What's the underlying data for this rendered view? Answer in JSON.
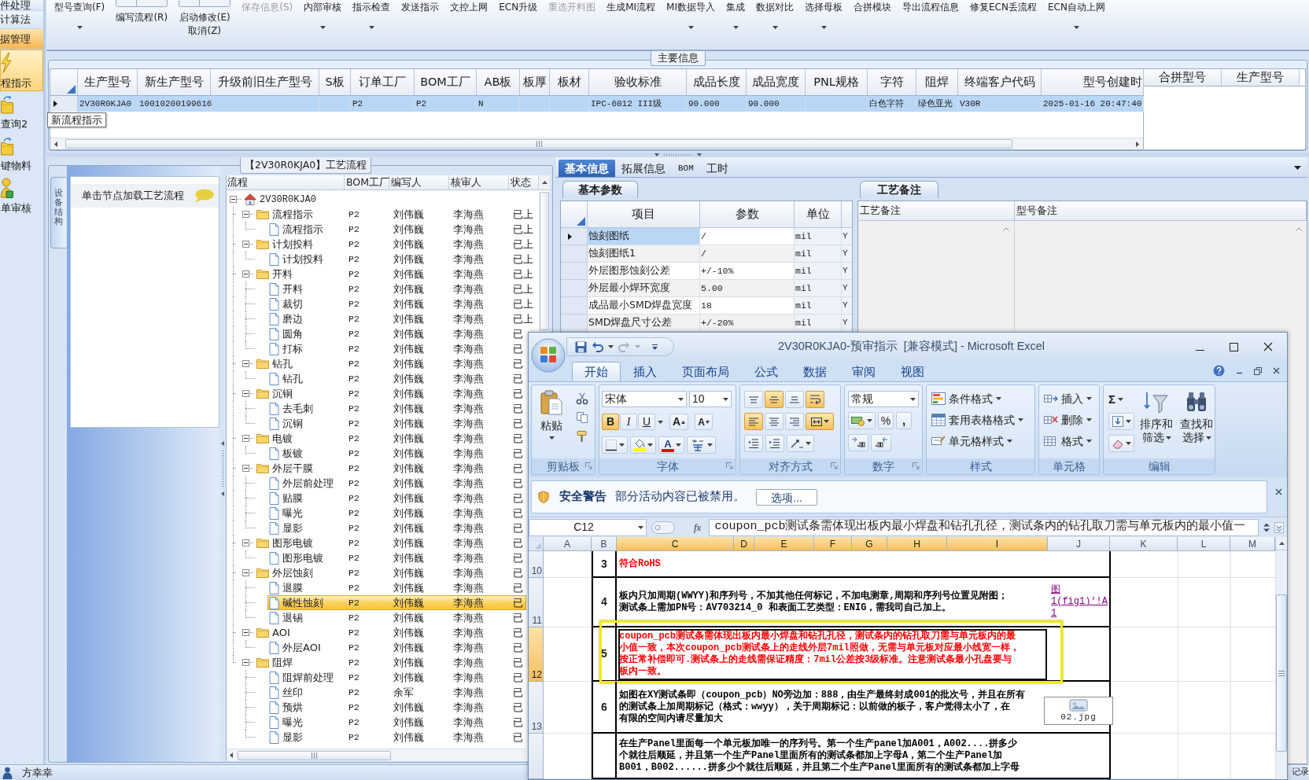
{
  "sidebar": {
    "sections": [
      {
        "label": "件处理",
        "selected": false
      },
      {
        "label": "计算法",
        "selected": false
      },
      {
        "label": "据管理",
        "selected": true
      }
    ],
    "shortcuts": [
      {
        "label": "程指示",
        "selected": true
      },
      {
        "label": "查询2",
        "selected": false
      },
      {
        "label": "键物料",
        "selected": false
      },
      {
        "label": "单审核",
        "selected": false
      }
    ]
  },
  "toolbar": {
    "buttons": [
      {
        "kind": "plain",
        "lines": [
          "型号查询(F)"
        ],
        "dropdown": true,
        "disabled": false
      },
      {
        "kind": "split",
        "lines": [
          "编写流程(R)"
        ],
        "dropdown": false,
        "disabled": false
      },
      {
        "kind": "split",
        "lines": [
          "启动修改(E)",
          "取消(Z)"
        ],
        "dropdown": false,
        "disabled": false
      },
      {
        "kind": "plain",
        "lines": [
          "保存信息(S)"
        ],
        "dropdown": false,
        "disabled": true
      },
      {
        "kind": "plain",
        "lines": [
          "内部审核"
        ],
        "dropdown": true,
        "disabled": false
      },
      {
        "kind": "plain",
        "lines": [
          "指示检查"
        ],
        "dropdown": true,
        "disabled": false
      },
      {
        "kind": "plain",
        "lines": [
          "发送指示"
        ],
        "dropdown": false,
        "disabled": false
      },
      {
        "kind": "plain",
        "lines": [
          "文控上网"
        ],
        "dropdown": false,
        "disabled": false
      },
      {
        "kind": "plain",
        "lines": [
          "ECN升级"
        ],
        "dropdown": false,
        "disabled": false
      },
      {
        "kind": "plain",
        "lines": [
          "重选开料图"
        ],
        "dropdown": false,
        "disabled": true
      },
      {
        "kind": "plain",
        "lines": [
          "生成MI流程"
        ],
        "dropdown": false,
        "disabled": false
      },
      {
        "kind": "plain",
        "lines": [
          "MI数据导入"
        ],
        "dropdown": true,
        "disabled": false
      },
      {
        "kind": "plain",
        "lines": [
          "集成"
        ],
        "dropdown": true,
        "disabled": false
      },
      {
        "kind": "plain",
        "lines": [
          "数据对比"
        ],
        "dropdown": true,
        "disabled": false
      },
      {
        "kind": "plain",
        "lines": [
          "选择母板"
        ],
        "dropdown": true,
        "disabled": false
      },
      {
        "kind": "plain",
        "lines": [
          "合拼模块"
        ],
        "dropdown": false,
        "disabled": false
      },
      {
        "kind": "plain",
        "lines": [
          "导出流程信息"
        ],
        "dropdown": false,
        "disabled": false
      },
      {
        "kind": "plain",
        "lines": [
          "修复ECN丢流程"
        ],
        "dropdown": false,
        "disabled": false
      },
      {
        "kind": "plain",
        "lines": [
          "ECN自动上网"
        ],
        "dropdown": true,
        "disabled": false
      }
    ]
  },
  "tooltip": {
    "text": "新流程指示"
  },
  "main_info": {
    "title": "主要信息",
    "columns": [
      "生产型号",
      "新生产型号",
      "升级前旧生产型号",
      "S板",
      "订单工厂",
      "BOM工厂",
      "AB板",
      "板厚",
      "板材",
      "验收标准",
      "成品长度",
      "成品宽度",
      "PNL规格",
      "字符",
      "阻焊",
      "终端客户代码",
      "型号创建时"
    ],
    "rows": [
      {
        "selected": true,
        "cells": [
          "2V30R0KJA0",
          "10010200199616",
          null,
          null,
          "P2",
          "P2",
          "N",
          null,
          null,
          "IPC-6012 III级",
          "90.000",
          "90.000",
          null,
          "白色字符",
          "绿色亚光",
          "V30R",
          "2025-01-16 20:47:40"
        ]
      }
    ],
    "merge_columns": [
      "合拼型号",
      "生产型号"
    ]
  },
  "process_panel": {
    "title": "【2V30R0KJA0】工艺流程",
    "side_tab": {
      "label": "设备结构",
      "selected": true
    },
    "hint": "单击节点加载工艺流程",
    "tree": {
      "columns": [
        "流程",
        "BOM工厂",
        "编写人",
        "核审人",
        "状态"
      ],
      "nodes": [
        {
          "label": "2V30R0KJA0",
          "expanded": true,
          "selected": false,
          "children": [
            {
              "label": "流程指示",
              "bom": "P2",
              "author": "刘伟巍",
              "reviewer": "李海燕",
              "status": "已上",
              "expanded": true,
              "selected": false,
              "children": [
                {
                  "label": "流程指示",
                  "bom": "P2",
                  "author": "刘伟巍",
                  "reviewer": "李海燕",
                  "status": "已上",
                  "selected": false
                }
              ]
            },
            {
              "label": "计划投料",
              "bom": "P2",
              "author": "刘伟巍",
              "reviewer": "李海燕",
              "status": "已上",
              "expanded": true,
              "selected": false,
              "children": [
                {
                  "label": "计划投料",
                  "bom": "P2",
                  "author": "刘伟巍",
                  "reviewer": "李海燕",
                  "status": "已上",
                  "selected": false
                }
              ]
            },
            {
              "label": "开料",
              "bom": "P2",
              "author": "刘伟巍",
              "reviewer": "李海燕",
              "status": "已上",
              "expanded": true,
              "selected": false,
              "children": [
                {
                  "label": "开料",
                  "bom": "P2",
                  "author": "刘伟巍",
                  "reviewer": "李海燕",
                  "status": "已上",
                  "selected": false
                },
                {
                  "label": "裁切",
                  "bom": "P2",
                  "author": "刘伟巍",
                  "reviewer": "李海燕",
                  "status": "已上",
                  "selected": false
                },
                {
                  "label": "磨边",
                  "bom": "P2",
                  "author": "刘伟巍",
                  "reviewer": "李海燕",
                  "status": "已上",
                  "selected": false
                },
                {
                  "label": "圆角",
                  "bom": "P2",
                  "author": "刘伟巍",
                  "reviewer": "李海燕",
                  "status": "已",
                  "selected": false
                },
                {
                  "label": "打标",
                  "bom": "P2",
                  "author": "刘伟巍",
                  "reviewer": "李海燕",
                  "status": "已",
                  "selected": false
                }
              ]
            },
            {
              "label": "钻孔",
              "bom": "P2",
              "author": "刘伟巍",
              "reviewer": "李海燕",
              "status": "已",
              "expanded": true,
              "selected": false,
              "children": [
                {
                  "label": "钻孔",
                  "bom": "P2",
                  "author": "刘伟巍",
                  "reviewer": "李海燕",
                  "status": "已",
                  "selected": false
                }
              ]
            },
            {
              "label": "沉铜",
              "bom": "P2",
              "author": "刘伟巍",
              "reviewer": "李海燕",
              "status": "已",
              "expanded": true,
              "selected": false,
              "children": [
                {
                  "label": "去毛刺",
                  "bom": "P2",
                  "author": "刘伟巍",
                  "reviewer": "李海燕",
                  "status": "已",
                  "selected": false
                },
                {
                  "label": "沉铜",
                  "bom": "P2",
                  "author": "刘伟巍",
                  "reviewer": "李海燕",
                  "status": "已",
                  "selected": false
                }
              ]
            },
            {
              "label": "电镀",
              "bom": "P2",
              "author": "刘伟巍",
              "reviewer": "李海燕",
              "status": "已",
              "expanded": true,
              "selected": false,
              "children": [
                {
                  "label": "板镀",
                  "bom": "P2",
                  "author": "刘伟巍",
                  "reviewer": "李海燕",
                  "status": "已",
                  "selected": false
                }
              ]
            },
            {
              "label": "外层干膜",
              "bom": "P2",
              "author": "刘伟巍",
              "reviewer": "李海燕",
              "status": "已",
              "expanded": true,
              "selected": false,
              "children": [
                {
                  "label": "外层前处理",
                  "bom": "P2",
                  "author": "刘伟巍",
                  "reviewer": "李海燕",
                  "status": "已",
                  "selected": false
                },
                {
                  "label": "贴膜",
                  "bom": "P2",
                  "author": "刘伟巍",
                  "reviewer": "李海燕",
                  "status": "已",
                  "selected": false
                },
                {
                  "label": "曝光",
                  "bom": "P2",
                  "author": "刘伟巍",
                  "reviewer": "李海燕",
                  "status": "已",
                  "selected": false
                },
                {
                  "label": "显影",
                  "bom": "P2",
                  "author": "刘伟巍",
                  "reviewer": "李海燕",
                  "status": "已",
                  "selected": false
                }
              ]
            },
            {
              "label": "图形电镀",
              "bom": "P2",
              "author": "刘伟巍",
              "reviewer": "李海燕",
              "status": "已",
              "expanded": true,
              "selected": false,
              "children": [
                {
                  "label": "图形电镀",
                  "bom": "P2",
                  "author": "刘伟巍",
                  "reviewer": "李海燕",
                  "status": "已",
                  "selected": false
                }
              ]
            },
            {
              "label": "外层蚀刻",
              "bom": "P2",
              "author": "刘伟巍",
              "reviewer": "李海燕",
              "status": "已",
              "expanded": true,
              "selected": false,
              "children": [
                {
                  "label": "退膜",
                  "bom": "P2",
                  "author": "刘伟巍",
                  "reviewer": "李海燕",
                  "status": "已",
                  "selected": false
                },
                {
                  "label": "碱性蚀刻",
                  "bom": "P2",
                  "author": "刘伟巍",
                  "reviewer": "李海燕",
                  "status": "已",
                  "selected": true
                },
                {
                  "label": "退锡",
                  "bom": "P2",
                  "author": "刘伟巍",
                  "reviewer": "李海燕",
                  "status": "已",
                  "selected": false
                }
              ]
            },
            {
              "label": "AOI",
              "bom": "P2",
              "author": "刘伟巍",
              "reviewer": "李海燕",
              "status": "已",
              "expanded": true,
              "selected": false,
              "children": [
                {
                  "label": "外层AOI",
                  "bom": "P2",
                  "author": "刘伟巍",
                  "reviewer": "李海燕",
                  "status": "已",
                  "selected": false
                }
              ]
            },
            {
              "label": "阻焊",
              "bom": "P2",
              "author": "刘伟巍",
              "reviewer": "李海燕",
              "status": "已",
              "expanded": true,
              "selected": false,
              "children": [
                {
                  "label": "阻焊前处理",
                  "bom": "P2",
                  "author": "刘伟巍",
                  "reviewer": "李海燕",
                  "status": "已",
                  "selected": false
                },
                {
                  "label": "丝印",
                  "bom": "P2",
                  "author": "余军",
                  "reviewer": "李海燕",
                  "status": "已",
                  "selected": false
                },
                {
                  "label": "预烘",
                  "bom": "P2",
                  "author": "刘伟巍",
                  "reviewer": "李海燕",
                  "status": "已",
                  "selected": false
                },
                {
                  "label": "曝光",
                  "bom": "P2",
                  "author": "刘伟巍",
                  "reviewer": "李海燕",
                  "status": "已",
                  "selected": false
                },
                {
                  "label": "显影",
                  "bom": "P2",
                  "author": "刘伟巍",
                  "reviewer": "李海燕",
                  "status": "已",
                  "selected": false
                }
              ]
            }
          ]
        }
      ]
    }
  },
  "detail_panel": {
    "tabs": [
      {
        "label": "基本信息",
        "selected": true
      },
      {
        "label": "拓展信息",
        "selected": false
      },
      {
        "label": "BOM",
        "selected": false
      },
      {
        "label": "工时",
        "selected": false
      }
    ],
    "params": {
      "tab": "基本参数",
      "columns": [
        "项目",
        "参数",
        "单位"
      ],
      "rows": [
        {
          "item": "蚀刻图纸",
          "value": "/",
          "unit": "mil",
          "column_4": "Y",
          "selected": true
        },
        {
          "item": "蚀刻图纸1",
          "value": "/",
          "unit": "mil",
          "column_4": "Y",
          "selected": false
        },
        {
          "item": "外层图形蚀刻公差",
          "value": "+/-10%",
          "unit": "mil",
          "column_4": "Y",
          "selected": false
        },
        {
          "item": "外层最小焊环宽度",
          "value": "5.00",
          "unit": "mil",
          "column_4": "Y",
          "selected": false
        },
        {
          "item": "成品最小SMD焊盘宽度",
          "value": "18",
          "unit": "mil",
          "column_4": "Y",
          "selected": false
        },
        {
          "item": "SMD焊盘尺寸公差",
          "value": "+/-20%",
          "unit": "mil",
          "column_4": "Y",
          "selected": false
        }
      ]
    },
    "notes": {
      "tab": "工艺备注",
      "columns": [
        "工艺备注",
        "型号备注"
      ]
    }
  },
  "excel": {
    "title": "2V30R0KJA0-预审指示  [兼容模式] - Microsoft Excel",
    "ribbon_tabs": [
      {
        "label": "开始",
        "selected": true
      },
      {
        "label": "插入",
        "selected": false
      },
      {
        "label": "页面布局",
        "selected": false
      },
      {
        "label": "公式",
        "selected": false
      },
      {
        "label": "数据",
        "selected": false
      },
      {
        "label": "审阅",
        "selected": false
      },
      {
        "label": "视图",
        "selected": false
      }
    ],
    "clipboard": {
      "label": "剪贴板",
      "paste": "粘贴"
    },
    "font": {
      "label": "字体",
      "name": "宋体",
      "size": "10",
      "styles": [
        {
          "label": "B",
          "selected": true
        },
        {
          "label": "I",
          "selected": false
        },
        {
          "label": "U",
          "selected": false
        }
      ],
      "grow": "A",
      "shrink": "A",
      "color_button": "A"
    },
    "alignment": {
      "label": "对齐方式",
      "buttons": [
        {
          "kind": "top",
          "selected": false
        },
        {
          "kind": "middle",
          "selected": true
        },
        {
          "kind": "bottom",
          "selected": false
        },
        {
          "kind": "wrap",
          "selected": true
        },
        {
          "kind": "left",
          "selected": true
        },
        {
          "kind": "center",
          "selected": false
        },
        {
          "kind": "right",
          "selected": false
        },
        {
          "kind": "merge",
          "selected": true
        }
      ]
    },
    "number": {
      "label": "数字",
      "format": "常规",
      "percent": "%",
      "comma": ","
    },
    "styles": {
      "label": "样式",
      "items": [
        "条件格式",
        "套用表格格式",
        "单元格样式"
      ]
    },
    "cells": {
      "label": "单元格",
      "items": [
        "插入",
        "删除",
        "格式"
      ]
    },
    "editing": {
      "label": "编辑",
      "sum": "Σ",
      "sort": [
        "排序和",
        "筛选"
      ],
      "find": [
        "查找和",
        "选择"
      ]
    },
    "security_bar": {
      "title": "安全警告",
      "message": "部分活动内容已被禁用。",
      "button": "选项..."
    },
    "formula_bar": {
      "name_box": "C12",
      "function_button": "fx",
      "formula": "coupon_pcb测试条需体现出板内最小焊盘和钻孔孔径，测试条内的钻孔取刀需与单元板内的最小值一"
    },
    "columns": [
      {
        "label": "A",
        "selected": false
      },
      {
        "label": "B",
        "selected": false
      },
      {
        "label": "C",
        "selected": true
      },
      {
        "label": "D",
        "selected": true
      },
      {
        "label": "E",
        "selected": true
      },
      {
        "label": "F",
        "selected": true
      },
      {
        "label": "G",
        "selected": true
      },
      {
        "label": "H",
        "selected": true
      },
      {
        "label": "I",
        "selected": true
      },
      {
        "label": "J",
        "selected": false
      },
      {
        "label": "K",
        "selected": false
      },
      {
        "label": "L",
        "selected": false
      },
      {
        "label": "M",
        "selected": false
      }
    ],
    "rows": [
      {
        "header": "10",
        "selected": false,
        "number": "3",
        "lines": [
          "符合RoHS"
        ],
        "color": "#ff0000",
        "highlighted": false
      },
      {
        "header": "11",
        "selected": false,
        "number": "4",
        "lines": [
          "板内只加周期(WWYY)和序列号，不加其他任何标记，不加电测章,周期和序列号位置见附图；",
          "测试条上需加PN号：AV703214_0 和表面工艺类型：ENIG，需我司自己加上。"
        ],
        "color": "#000000",
        "highlighted": false,
        "link": "图1(fig1)'!A1"
      },
      {
        "header": "12",
        "selected": true,
        "number": "5",
        "lines": [
          "coupon_pcb测试条需体现出板内最小焊盘和钻孔孔径，测试条内的钻孔取刀需与单元板内的最",
          "小值一致，本次coupon_pcb测试条上的走线外层7mil照做，无需与单元板对应最小线宽一样，",
          "按正常补偿即可.测试条上的走线需保证精度：7mil公差按3级标准。注意测试条最小孔盘要与",
          "板内一致。"
        ],
        "color": "#ff0000",
        "highlighted": true
      },
      {
        "header": "13",
        "selected": false,
        "number": "6",
        "lines": [
          "如图在XY测试条即（coupon_pcb）NO旁边加：888，由生产最终封成001的批次号，并且在所有",
          "的测试条上加周期标记（格式：wwyy），关于周期标记：以前做的板子，客户觉得太小了，在",
          "有限的空间内请尽量加大"
        ],
        "color": "#000000",
        "highlighted": false,
        "attachment": "02.jpg"
      },
      {
        "selected": false,
        "lines": [
          "在生产Panel里面每一个单元板加唯一的序列号。第一个生产panel加A001，A002....拼多少",
          "个就往后顺延，并且第一个生产Panel里面所有的测试条都加上字母A，第二个生产Panel加",
          "B001，B002......拼多少个就往后顺延，并且第二个生产Panel里面所有的测试条都加上字母"
        ],
        "color": "#000000",
        "highlighted": false
      }
    ]
  },
  "status_bar": {
    "user": "方幸幸",
    "right_text": "记录"
  }
}
